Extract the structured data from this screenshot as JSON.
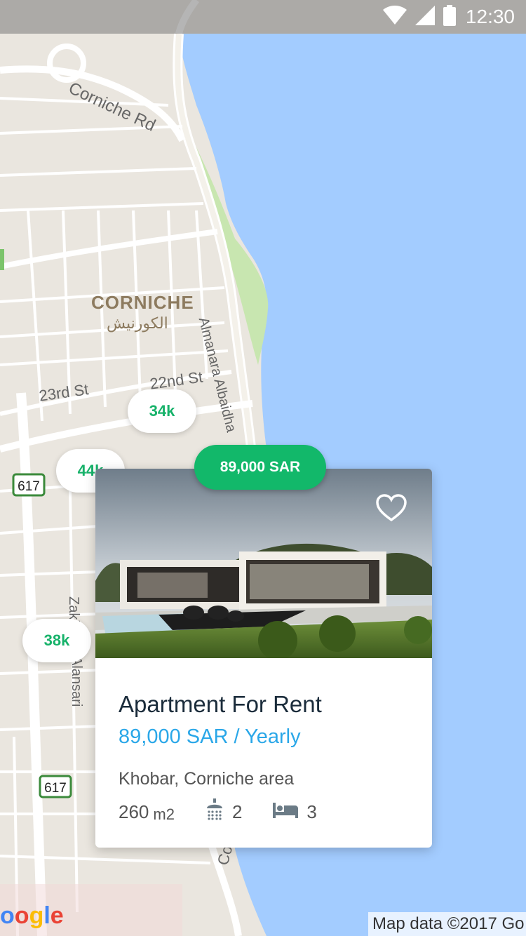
{
  "status_bar": {
    "time": "12:30"
  },
  "map": {
    "labels": {
      "corniche_rd_top": "Corniche Rd",
      "district": "CORNICHE",
      "district_ar": "الكورنيش",
      "street_23": "23rd St",
      "street_22": "22nd St",
      "almanara": "Almanara Albaidha",
      "zaki": "Zaki",
      "ansari": "Alansari",
      "corniche_rd_bottom": "Corniche Rd",
      "route_617": "617"
    },
    "attribution": "Map data ©2017 Go",
    "logo": "oogle"
  },
  "pins": [
    {
      "label": "34k"
    },
    {
      "label": "44k"
    },
    {
      "label": "38k"
    }
  ],
  "active_pin": {
    "label": "89,000 SAR"
  },
  "listing": {
    "title": "Apartment For Rent",
    "price": "89,000 SAR / Yearly",
    "location": "Khobar, Corniche area",
    "area": "260",
    "area_unit": "m2",
    "bathrooms": "2",
    "bedrooms": "3"
  },
  "colors": {
    "accent_green": "#12b86a",
    "price_blue": "#2aa7e8",
    "water": "#a3ccff",
    "land": "#eae6df"
  }
}
